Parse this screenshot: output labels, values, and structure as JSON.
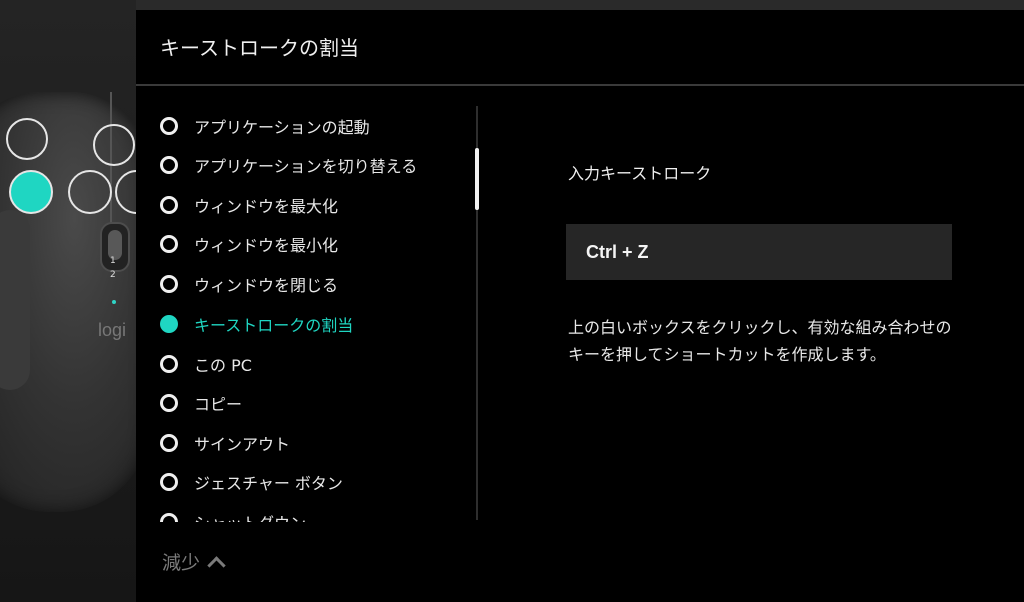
{
  "header": {
    "title": "キーストロークの割当"
  },
  "mouse": {
    "logo": "logi",
    "mode_labels": [
      "1",
      "2"
    ]
  },
  "actions": {
    "items": [
      {
        "label": "アプリケーションの起動",
        "selected": false
      },
      {
        "label": "アプリケーションを切り替える",
        "selected": false
      },
      {
        "label": "ウィンドウを最大化",
        "selected": false
      },
      {
        "label": "ウィンドウを最小化",
        "selected": false
      },
      {
        "label": "ウィンドウを閉じる",
        "selected": false
      },
      {
        "label": "キーストロークの割当",
        "selected": true
      },
      {
        "label": "この PC",
        "selected": false
      },
      {
        "label": "コピー",
        "selected": false
      },
      {
        "label": "サインアウト",
        "selected": false
      },
      {
        "label": "ジェスチャー ボタン",
        "selected": false
      },
      {
        "label": "シャットダウン",
        "selected": false
      }
    ],
    "less_label": "減少"
  },
  "keystroke": {
    "title": "入力キーストローク",
    "value": "Ctrl + Z",
    "help": "上の白いボックスをクリックし、有効な組み合わせのキーを押してショートカットを作成します。"
  },
  "colors": {
    "accent": "#1fd6c2",
    "background": "#000000",
    "input_bg": "#262626"
  }
}
